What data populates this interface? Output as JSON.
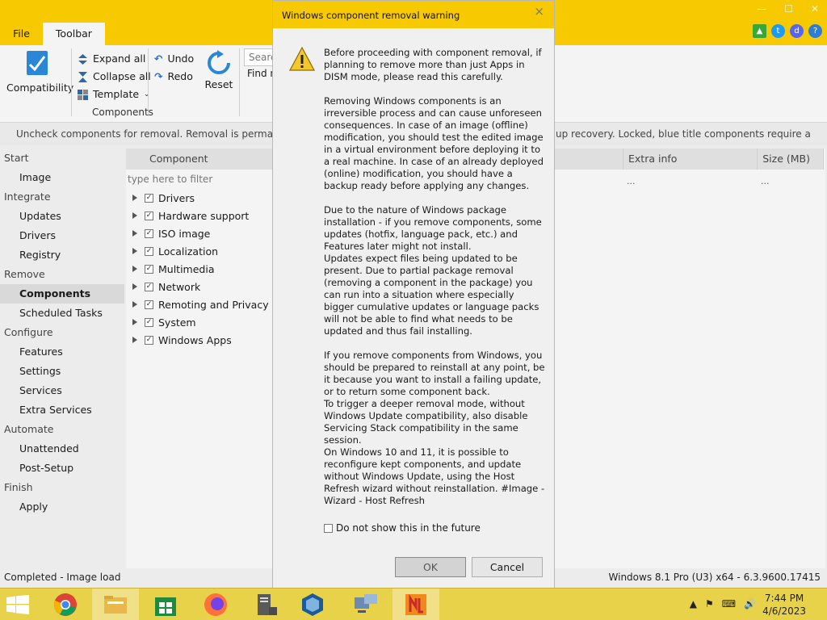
{
  "menu": {
    "file": "File",
    "toolbar": "Toolbar"
  },
  "ribbon": {
    "compatibility": "Compatibility",
    "expand_all": "Expand all",
    "collapse_all": "Collapse all",
    "template": "Template",
    "undo": "Undo",
    "redo": "Redo",
    "reset": "Reset",
    "search_placeholder": "Search",
    "find": "Find n",
    "group_label": "Components"
  },
  "info_bar": {
    "left": "Uncheck components for removal. Removal is permanent, re",
    "right": "up recovery. Locked, blue title components require a license."
  },
  "nav": [
    {
      "label": "Start",
      "type": "cat"
    },
    {
      "label": "Image",
      "type": "sub"
    },
    {
      "label": "Integrate",
      "type": "cat"
    },
    {
      "label": "Updates",
      "type": "sub"
    },
    {
      "label": "Drivers",
      "type": "sub"
    },
    {
      "label": "Registry",
      "type": "sub"
    },
    {
      "label": "Remove",
      "type": "cat"
    },
    {
      "label": "Components",
      "type": "sub",
      "selected": true
    },
    {
      "label": "Scheduled Tasks",
      "type": "sub"
    },
    {
      "label": "Configure",
      "type": "cat"
    },
    {
      "label": "Features",
      "type": "sub"
    },
    {
      "label": "Settings",
      "type": "sub"
    },
    {
      "label": "Services",
      "type": "sub"
    },
    {
      "label": "Extra Services",
      "type": "sub"
    },
    {
      "label": "Automate",
      "type": "cat"
    },
    {
      "label": "Unattended",
      "type": "sub"
    },
    {
      "label": "Post-Setup",
      "type": "sub"
    },
    {
      "label": "Finish",
      "type": "cat"
    },
    {
      "label": "Apply",
      "type": "sub"
    }
  ],
  "columns": {
    "component": "Component",
    "extra_info": "Extra info",
    "size": "Size (MB)"
  },
  "filter_placeholder": "type here to filter",
  "row_dots": {
    "extra": "...",
    "size": "..."
  },
  "tree": [
    "Drivers",
    "Hardware support",
    "ISO image",
    "Localization",
    "Multimedia",
    "Network",
    "Remoting and Privacy",
    "System",
    "Windows Apps"
  ],
  "status": {
    "left": "Completed - Image load",
    "right": "Windows 8.1 Pro (U3) x64 - 6.3.9600.17415"
  },
  "dialog": {
    "title": "Windows component removal warning",
    "close": "×",
    "body": "Before proceeding with component removal, if planning to remove more than just Apps in DISM mode, please read this carefully.\n\nRemoving Windows components is an irreversible process and can cause unforeseen consequences. In case of an image (offline) modification, you should test the edited image in a virtual environment before deploying it to a real machine. In case of an already deployed (online) modification, you should have a backup ready before applying any changes.\n\nDue to the nature of Windows package installation - if you remove components, some updates (hotfix, language pack, etc.) and Features later might not install.\nUpdates expect files being updated to be present. Due to partial package removal (removing a component in the package) you can run into a situation where especially bigger cumulative updates or language packs will not be able to find what needs to be updated and thus fail installing.\n\nIf you remove components from Windows, you should be prepared to reinstall at any point, be it because you want to install a failing update, or to return some component back.\nTo trigger a deeper removal mode, without Windows Update compatibility, also disable Servicing Stack compatibility in the same session.\nOn Windows 10 and 11, it is possible to reconfigure kept components, and update without Windows Update, using the Host Refresh wizard without reinstallation. #Image - Wizard - Host Refresh",
    "checkbox": "Do not show this in the future",
    "ok": "OK",
    "cancel": "Cancel"
  },
  "taskbar": {
    "time": "7:44 PM",
    "date": "4/6/2023",
    "apps": [
      "chrome",
      "file-explorer",
      "store",
      "firefox",
      "server-manager",
      "virtualbox",
      "network-computer",
      "ntlite"
    ]
  },
  "colors": {
    "accent": "#f7c900",
    "taskbar": "#e8d24a"
  }
}
